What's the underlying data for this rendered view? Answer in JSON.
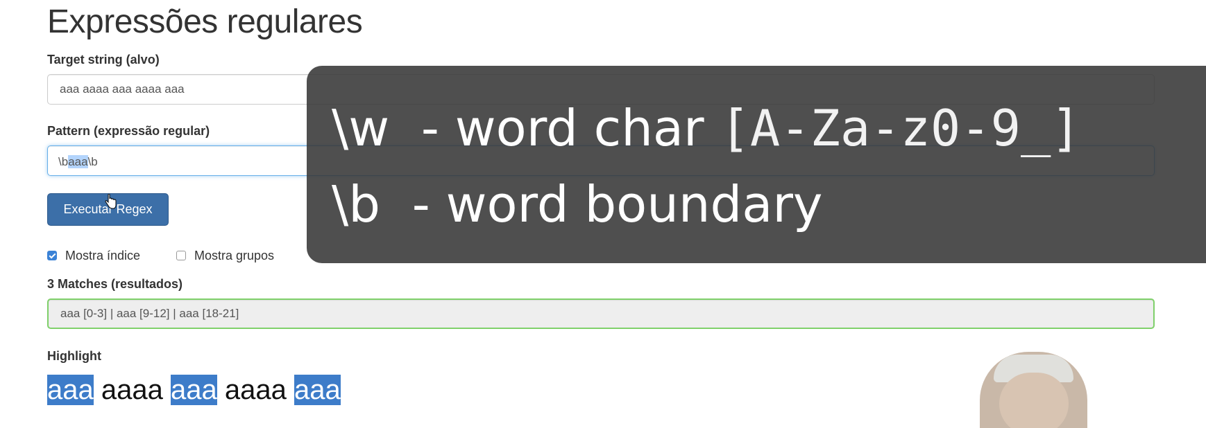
{
  "page": {
    "title": "Expressões regulares"
  },
  "target": {
    "label": "Target string (alvo)",
    "value": "aaa aaaa aaa aaaa aaa"
  },
  "pattern": {
    "label": "Pattern (expressão regular)",
    "prefix": "\\b",
    "selected": "aaa",
    "suffix": "\\b"
  },
  "run_button": {
    "label": "Executar Regex"
  },
  "options": {
    "show_index_label": "Mostra índice",
    "show_index_checked": true,
    "show_groups_label": "Mostra grupos",
    "show_groups_checked": false
  },
  "results": {
    "label": "3 Matches (resultados)",
    "value": "aaa [0-3] | aaa [9-12] | aaa [18-21]"
  },
  "highlight": {
    "label": "Highlight",
    "tokens": [
      {
        "text": "aaa",
        "match": true
      },
      {
        "text": " ",
        "match": false
      },
      {
        "text": "aaaa",
        "match": false
      },
      {
        "text": " ",
        "match": false
      },
      {
        "text": "aaa",
        "match": true
      },
      {
        "text": " ",
        "match": false
      },
      {
        "text": "aaaa",
        "match": false
      },
      {
        "text": " ",
        "match": false
      },
      {
        "text": "aaa",
        "match": true
      }
    ]
  },
  "overlay": {
    "line1_token": "\\w",
    "line1_desc": "  - word char ",
    "line1_class": "[A-Za-z0-9_]",
    "line2_token": "\\b",
    "line2_desc": "  - word boundary"
  },
  "colors": {
    "button_bg": "#3c6fa8",
    "highlight_bg": "#3d7cc9",
    "result_border": "#7fd06a",
    "overlay_bg": "#373737"
  }
}
